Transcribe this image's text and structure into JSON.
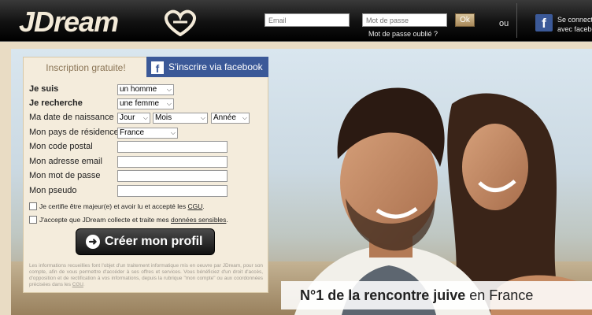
{
  "header": {
    "logo_text": "JDream",
    "email_placeholder": "Email",
    "password_placeholder": "Mot de passe",
    "ok_label": "Ok",
    "forgot_password": "Mot de passe oublié ?",
    "or_label": "ou",
    "fb_connect_line1": "Se connect",
    "fb_connect_line2": "avec facebo"
  },
  "form": {
    "tab_inscription": "Inscription gratuite!",
    "tab_facebook": "S'inscrire via facebook",
    "je_suis_label": "Je suis",
    "je_suis_value": "un homme",
    "je_recherche_label": "Je recherche",
    "je_recherche_value": "une femme",
    "birthdate_label": "Ma date de naissance",
    "day_value": "Jour",
    "month_value": "Mois",
    "year_value": "Année",
    "country_label": "Mon pays de résidence",
    "country_value": "France",
    "postal_label": "Mon code postal",
    "email_label": "Mon adresse email",
    "password_label": "Mon mot de passe",
    "pseudo_label": "Mon pseudo",
    "cb1_text": "Je certifie être majeur(e) et avoir lu et accepté les",
    "cb1_link": "CGU",
    "cb1_end": ".",
    "cb2_text": "J'accepte que JDream collecte et traite mes",
    "cb2_link": "données sensibles",
    "cb2_end": ".",
    "create_button": "Créer mon profil",
    "legal_text": "Les informations recueillies font l'objet d'un traitement informatique mis en oeuvre par JDream, pour son compte, afin de vous permettre d'accéder à ses offres et services. Vous bénéficiez d'un droit d'accès, d'opposition et de rectification à vos informations, depuis la rubrique \"mon compte\" ou aux coordonnées précisées dans les",
    "legal_link": "CGU",
    "legal_end": "."
  },
  "hero": {
    "tagline_bold": "N°1 de la rencontre juive",
    "tagline_rest": " en France"
  },
  "colors": {
    "facebook_blue": "#3b5998",
    "panel_bg": "#f4ecdc",
    "header_bg": "#111111"
  }
}
